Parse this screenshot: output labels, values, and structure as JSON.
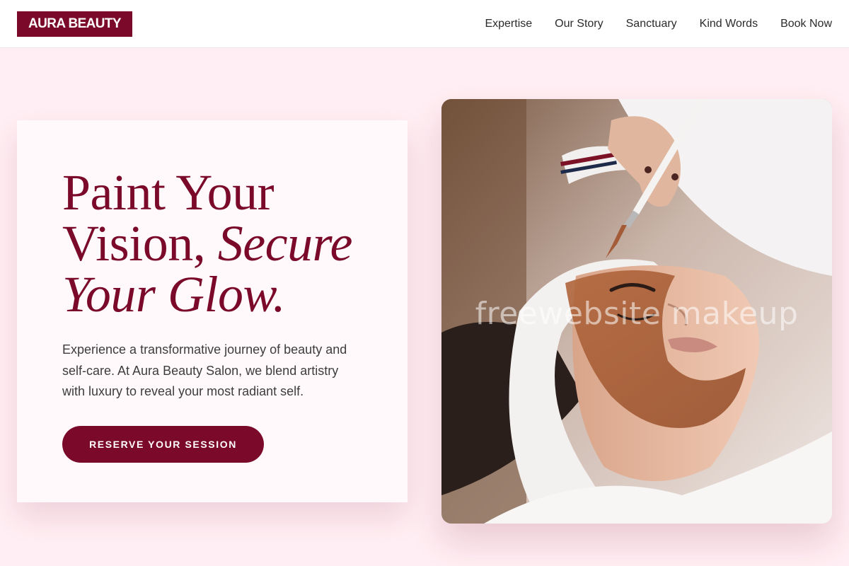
{
  "brand": {
    "logo_text": "AURA BEAUTY",
    "primary_color": "#7b0a2a",
    "background_color": "#ffeef3"
  },
  "nav": {
    "items": [
      {
        "label": "Expertise"
      },
      {
        "label": "Our Story"
      },
      {
        "label": "Sanctuary"
      },
      {
        "label": "Kind Words"
      },
      {
        "label": "Book Now"
      }
    ]
  },
  "hero": {
    "headline_line1": "Paint Your",
    "headline_line2_plain": "Vision, ",
    "headline_line2_italic": "Secure",
    "headline_line3_italic": "Your Glow.",
    "description": "Experience a transformative journey of beauty and self-care. At Aura Beauty Salon, we blend artistry with luxury to reveal your most radiant self.",
    "cta_label": "RESERVE YOUR SESSION"
  },
  "hero_image": {
    "subject": "facial clay mask treatment applied with a brush",
    "watermark_text": "freewebsite makeup"
  }
}
